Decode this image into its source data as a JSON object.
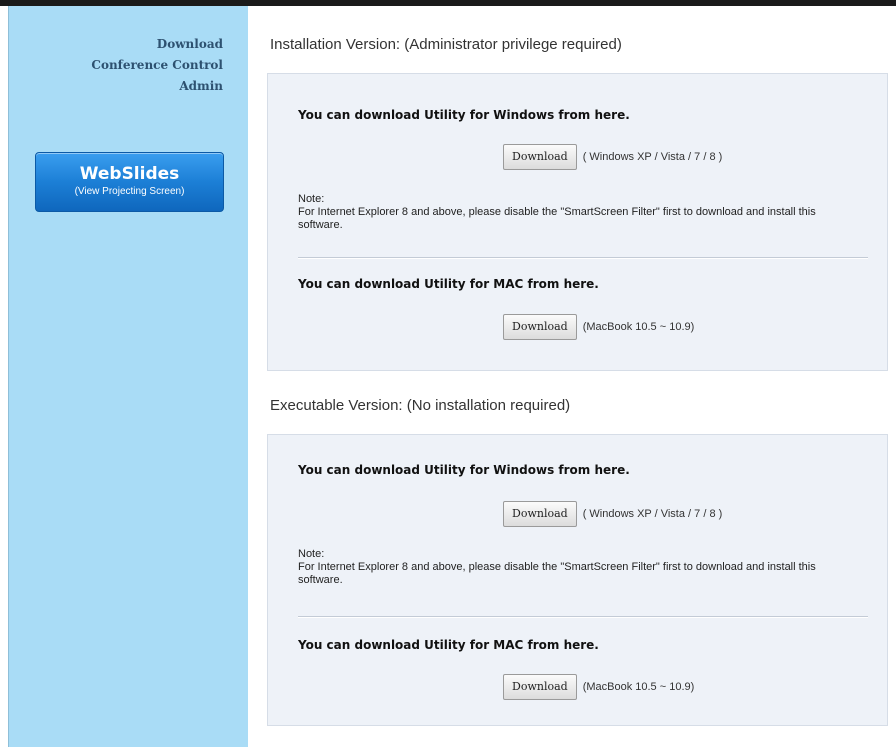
{
  "sidebar": {
    "nav": [
      "Download",
      "Conference Control",
      "Admin"
    ],
    "webslides": {
      "title": "WebSlides",
      "subtitle": "(View Projecting Screen)"
    }
  },
  "sections": [
    {
      "title": "Installation Version: (Administrator privilege required)",
      "windows_heading": "You can download Utility for Windows from here.",
      "windows_button": "Download",
      "windows_compat": "( Windows XP / Vista / 7 / 8 )",
      "note_title": "Note:",
      "note_text": "For Internet Explorer 8 and above, please disable the \"SmartScreen Filter\" first to download and install this software.",
      "mac_heading": "You can download Utility for MAC from here.",
      "mac_button": "Download",
      "mac_compat": "(MacBook 10.5 ~ 10.9)"
    },
    {
      "title": "Executable Version: (No installation required)",
      "windows_heading": "You can download Utility for Windows from here.",
      "windows_button": "Download",
      "windows_compat": "( Windows XP / Vista / 7 / 8 )",
      "note_title": "Note:",
      "note_text": "For Internet Explorer 8 and above, please disable the \"SmartScreen Filter\" first to download and install this software.",
      "mac_heading": "You can download Utility for MAC from here.",
      "mac_button": "Download",
      "mac_compat": "(MacBook 10.5 ~ 10.9)"
    }
  ]
}
